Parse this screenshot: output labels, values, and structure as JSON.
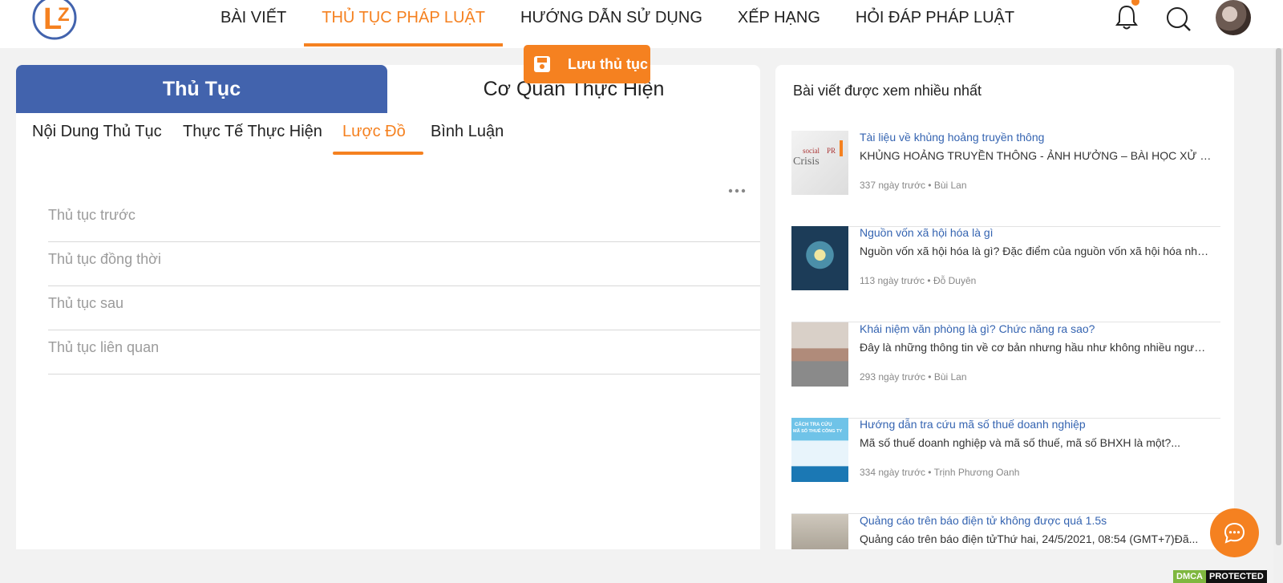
{
  "header": {
    "nav": [
      {
        "label": "BÀI VIẾT",
        "active": false
      },
      {
        "label": "THỦ TỤC PHÁP LUẬT",
        "active": true
      },
      {
        "label": "HƯỚNG DẪN SỬ DỤNG",
        "active": false
      },
      {
        "label": "XẾP HẠNG",
        "active": false
      },
      {
        "label": "HỎI ĐÁP PHÁP LUẬT",
        "active": false
      }
    ],
    "icons": [
      "bell-icon",
      "search-icon"
    ],
    "accent": "#f58120"
  },
  "main": {
    "tabs": [
      {
        "label": "Thủ Tục",
        "active": true
      },
      {
        "label": "Cơ Quan Thực Hiện",
        "active": false
      }
    ],
    "subtabs": [
      {
        "label": "Nội Dung Thủ Tục"
      },
      {
        "label": "Thực Tế Thực Hiện"
      },
      {
        "label": "Lược Đồ",
        "active": true
      },
      {
        "label": "Bình Luận"
      }
    ],
    "save_label": "Lưu thủ tục",
    "fields": [
      {
        "placeholder": "Thủ tục trước"
      },
      {
        "placeholder": "Thủ tục đồng thời"
      },
      {
        "placeholder": "Thủ tục sau"
      },
      {
        "placeholder": "Thủ tục liên quan"
      }
    ],
    "tab_color": "#4263ad"
  },
  "sidebar": {
    "title": "Bài viết được xem nhiều nhất",
    "articles": [
      {
        "title": "Tài liệu về khủng hoảng truyền thông",
        "desc": "KHỦNG HOẢNG TRUYỀN THÔNG - ẢNH HƯỞNG – BÀI HỌC XỬ LÝ ...",
        "time": "337 ngày trước",
        "author": "Bùi Lan"
      },
      {
        "title": "Nguồn vốn xã hội hóa là gì",
        "desc": "Nguồn vốn xã hội hóa là gì? Đặc điểm của nguồn vốn xã hội hóa như...",
        "time": "113 ngày trước",
        "author": "Đỗ Duyên"
      },
      {
        "title": "Khái niệm văn phòng là gì? Chức năng ra sao?",
        "desc": "Đây là những thông tin về cơ bản nhưng hầu như không nhiều người...",
        "time": "293 ngày trước",
        "author": "Bùi Lan"
      },
      {
        "title": "Hướng dẫn tra cứu mã số thuế doanh nghiệp",
        "desc": "Mã số thuế doanh nghiệp và mã số thuế, mã số BHXH là một?...",
        "time": "334 ngày trước",
        "author": "Trịnh Phương Oanh"
      },
      {
        "title": "Quảng cáo trên báo điện tử không được quá 1.5s",
        "desc": "Quảng cáo trên báo điện tửThứ hai, 24/5/2021, 08:54 (GMT+7)Đã...",
        "time": "",
        "author": ""
      }
    ],
    "thumb_captions": [
      "social PR Crisis",
      "CÁCH TRA CỨU MÃ SỐ THUẾ CÔNG TY"
    ]
  },
  "footer": {
    "dmca_left": "DMCA",
    "dmca_right": "PROTECTED"
  }
}
